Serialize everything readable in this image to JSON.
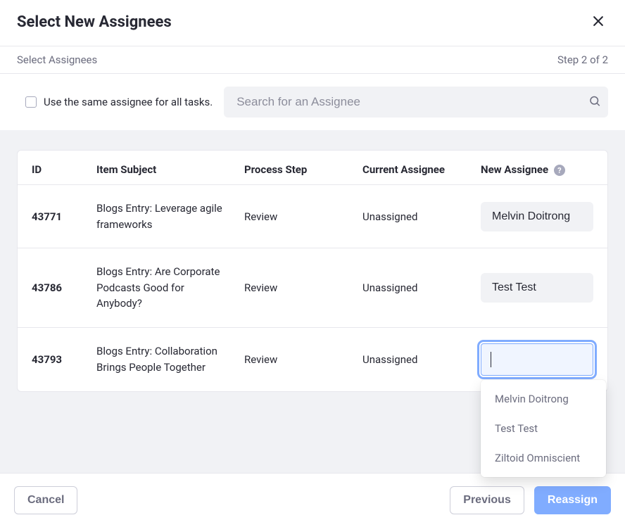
{
  "header": {
    "title": "Select New Assignees"
  },
  "subheader": {
    "left": "Select Assignees",
    "right": "Step 2 of 2"
  },
  "filter": {
    "checkbox_label": "Use the same assignee for all tasks.",
    "search_placeholder": "Search for an Assignee"
  },
  "table": {
    "columns": {
      "id": "ID",
      "subject": "Item Subject",
      "step": "Process Step",
      "current": "Current Assignee",
      "new": "New Assignee"
    },
    "rows": [
      {
        "id": "43771",
        "subject": "Blogs Entry: Leverage agile frameworks",
        "step": "Review",
        "current": "Unassigned",
        "new_assignee": "Melvin Doitrong"
      },
      {
        "id": "43786",
        "subject": "Blogs Entry: Are Corporate Podcasts Good for Anybody?",
        "step": "Review",
        "current": "Unassigned",
        "new_assignee": "Test Test"
      },
      {
        "id": "43793",
        "subject": "Blogs Entry: Collaboration Brings People Together",
        "step": "Review",
        "current": "Unassigned",
        "new_assignee": ""
      }
    ]
  },
  "dropdown": {
    "options": [
      "Melvin Doitrong",
      "Test Test",
      "Ziltoid Omniscient"
    ]
  },
  "footer": {
    "cancel": "Cancel",
    "previous": "Previous",
    "reassign": "Reassign"
  }
}
